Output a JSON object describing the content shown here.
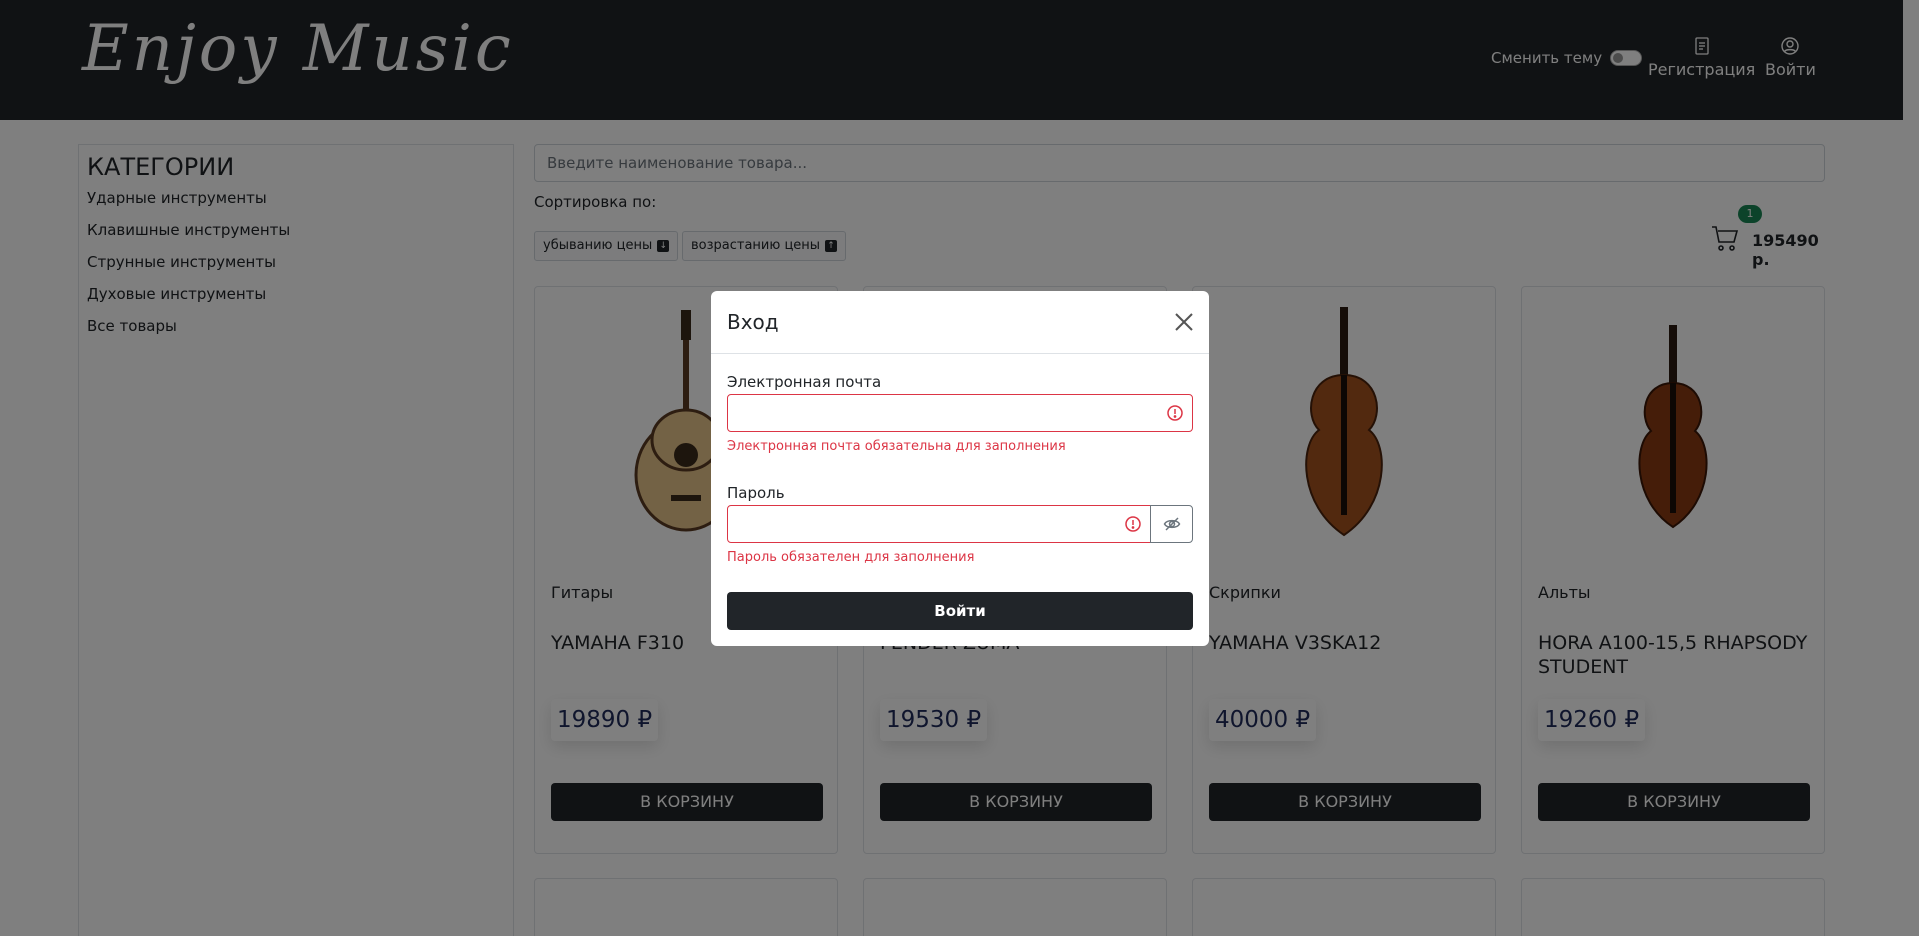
{
  "header": {
    "logo": "Enjoy Music",
    "theme_label": "Сменить тему",
    "register_label": "Регистрация",
    "login_label": "Войти"
  },
  "sidebar": {
    "title": "КАТЕГОРИИ",
    "items": [
      {
        "label": "Ударные инструменты"
      },
      {
        "label": "Клавишные инструменты"
      },
      {
        "label": "Струнные инструменты"
      },
      {
        "label": "Духовые инструменты"
      },
      {
        "label": "Все товары"
      }
    ]
  },
  "search": {
    "placeholder": "Введите наименование товара..."
  },
  "sort": {
    "label": "Сортировка по:",
    "desc_label": "убыванию цены",
    "asc_label": "возрастанию цены"
  },
  "cart": {
    "count": "1",
    "total": "195490 р."
  },
  "products": [
    {
      "category": "Гитары",
      "title": "YAMAHA F310",
      "price": "19890 ₽",
      "button": "В КОРЗИНУ"
    },
    {
      "category": "",
      "title": "FENDER ZUMA",
      "price": "19530 ₽",
      "button": "В КОРЗИНУ"
    },
    {
      "category": "Скрипки",
      "title": "YAMAHA V3SKA12",
      "price": "40000 ₽",
      "button": "В КОРЗИНУ"
    },
    {
      "category": "Альты",
      "title": "HORA A100-15,5 RHAPSODY STUDENT",
      "price": "19260 ₽",
      "button": "В КОРЗИНУ"
    }
  ],
  "modal": {
    "title": "Вход",
    "email_label": "Электронная почта",
    "email_error": "Электронная почта обязательна для заполнения",
    "password_label": "Пароль",
    "password_error": "Пароль обязателен для заполнения",
    "submit_label": "Войти"
  },
  "colors": {
    "header_bg": "#212529",
    "error": "#dc3545",
    "badge": "#198754",
    "price_text": "#1f2a5a"
  }
}
